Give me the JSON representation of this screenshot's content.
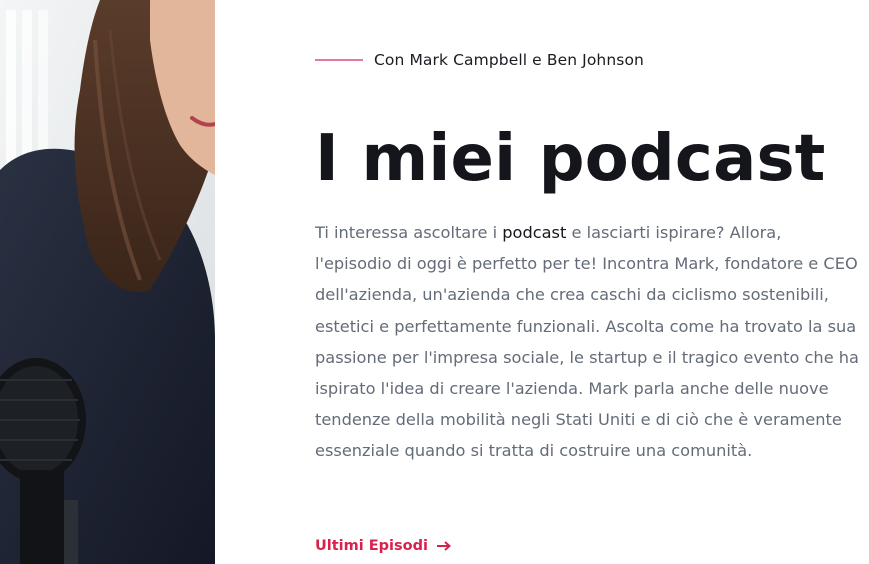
{
  "hero": {
    "eyebrow": "Con Mark Campbell e Ben Johnson",
    "title": "I miei podcast",
    "description": {
      "before": "Ti interessa ascoltare i ",
      "highlight": "podcast",
      "after": " e lasciarti ispirare? Allora, l'episodio di oggi è perfetto per te! Incontra Mark, fondatore e CEO dell'azienda, un'azienda che crea caschi da ciclismo sostenibili, estetici e perfettamente funzionali. Ascolta come ha trovato la sua passione per l'impresa sociale, le startup e il tragico evento che ha ispirato l'idea di creare l'azienda. Mark parla anche delle nuove tendenze della mobilità negli Stati Uniti e di ciò che è veramente essenziale quando si tratta di costruire una comunità."
    },
    "cta_label": "Ultimi Episodi",
    "cta_icon": "arrow-right-icon"
  },
  "colors": {
    "accent": "#d8224d",
    "accent_line": "#e37a9b",
    "heading": "#15151c",
    "body_text": "#646c78"
  }
}
